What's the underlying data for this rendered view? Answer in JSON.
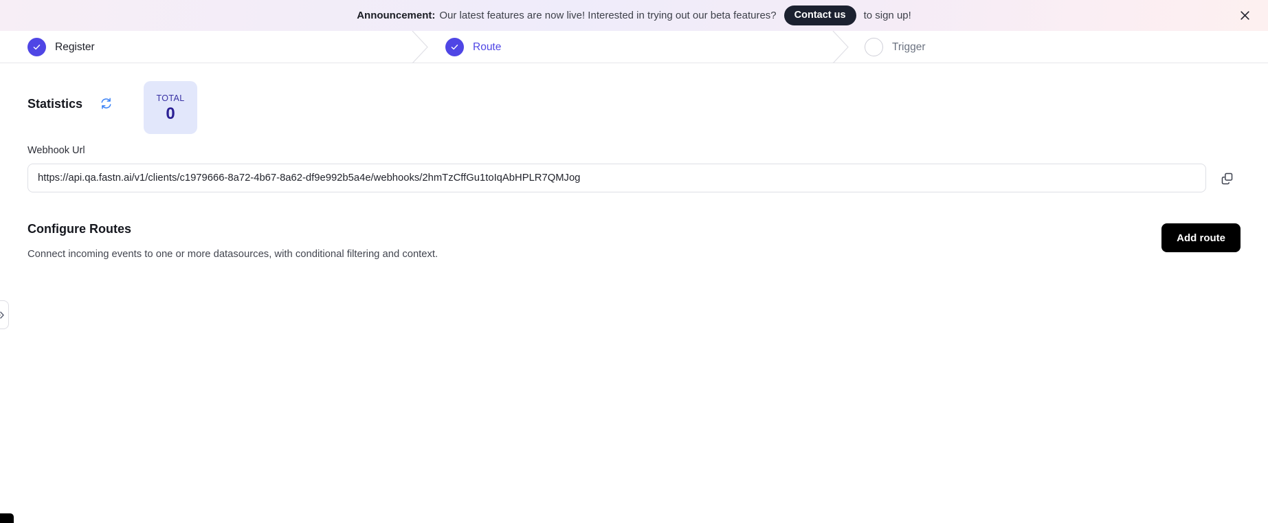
{
  "announcement": {
    "label": "Announcement:",
    "message": "Our latest features are now live! Interested in trying out our beta features?",
    "cta_label": "Contact us",
    "suffix": "to sign up!",
    "close_icon": "close-icon"
  },
  "stepper": {
    "steps": [
      {
        "label": "Register",
        "state": "done",
        "icon": "check-icon"
      },
      {
        "label": "Route",
        "state": "current",
        "icon": "check-icon"
      },
      {
        "label": "Trigger",
        "state": "todo",
        "icon": "empty-circle-icon"
      }
    ]
  },
  "edge_handle": {
    "icon": "chevron-double-right-icon"
  },
  "statistics": {
    "title": "Statistics",
    "refresh_icon": "refresh-icon",
    "cards": [
      {
        "label": "TOTAL",
        "value": "0"
      }
    ]
  },
  "webhook": {
    "label": "Webhook Url",
    "value": "https://api.qa.fastn.ai/v1/clients/c1979666-8a72-4b67-8a62-df9e992b5a4e/webhooks/2hmTzCffGu1toIqAbHPLR7QMJog",
    "placeholder": "Webhook Url",
    "copy_icon": "copy-icon"
  },
  "routes": {
    "title": "Configure Routes",
    "description": "Connect incoming events to one or more datasources, with conditional filtering and context.",
    "add_label": "Add route"
  },
  "colors": {
    "accent": "#4f46e5",
    "card_bg": "#e2e7fb",
    "card_text": "#2b2094",
    "button_dark": "#000000",
    "pill_dark": "#1c2130"
  }
}
